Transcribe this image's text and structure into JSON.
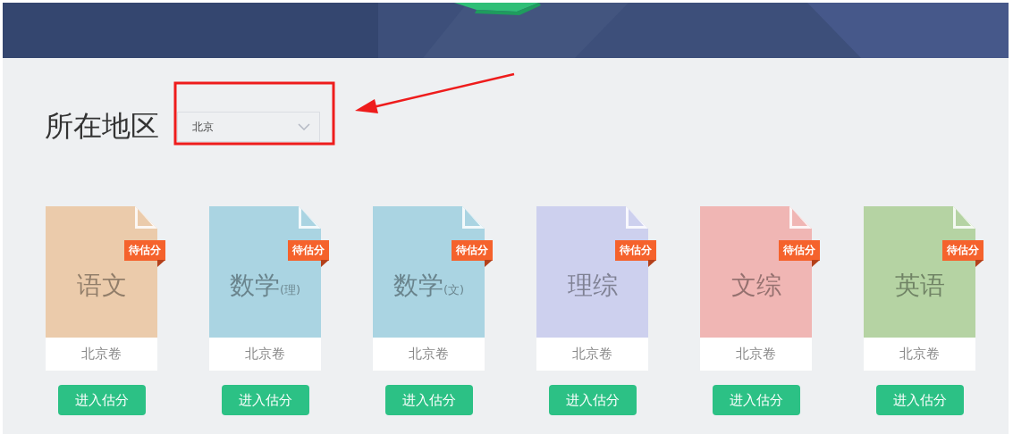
{
  "region": {
    "label": "所在地区",
    "select": {
      "value": "北京"
    }
  },
  "annotation": {
    "kind": "highlight"
  },
  "subjects": [
    {
      "name": "语文",
      "color": "#ebcbab",
      "badge": "待估分",
      "paper": "北京卷",
      "button": "进入估分"
    },
    {
      "name": "数学",
      "sub": "(理)",
      "color": "#aad4e2",
      "badge": "待估分",
      "paper": "北京卷",
      "button": "进入估分"
    },
    {
      "name": "数学",
      "sub": "(文)",
      "color": "#aad4e2",
      "badge": "待估分",
      "paper": "北京卷",
      "button": "进入估分"
    },
    {
      "name": "理综",
      "color": "#cdd0ee",
      "badge": "待估分",
      "paper": "北京卷",
      "button": "进入估分"
    },
    {
      "name": "文综",
      "color": "#f0b6b4",
      "badge": "待估分",
      "paper": "北京卷",
      "button": "进入估分"
    },
    {
      "name": "英语",
      "color": "#b5d3a3",
      "badge": "待估分",
      "paper": "北京卷",
      "button": "进入估分"
    }
  ]
}
